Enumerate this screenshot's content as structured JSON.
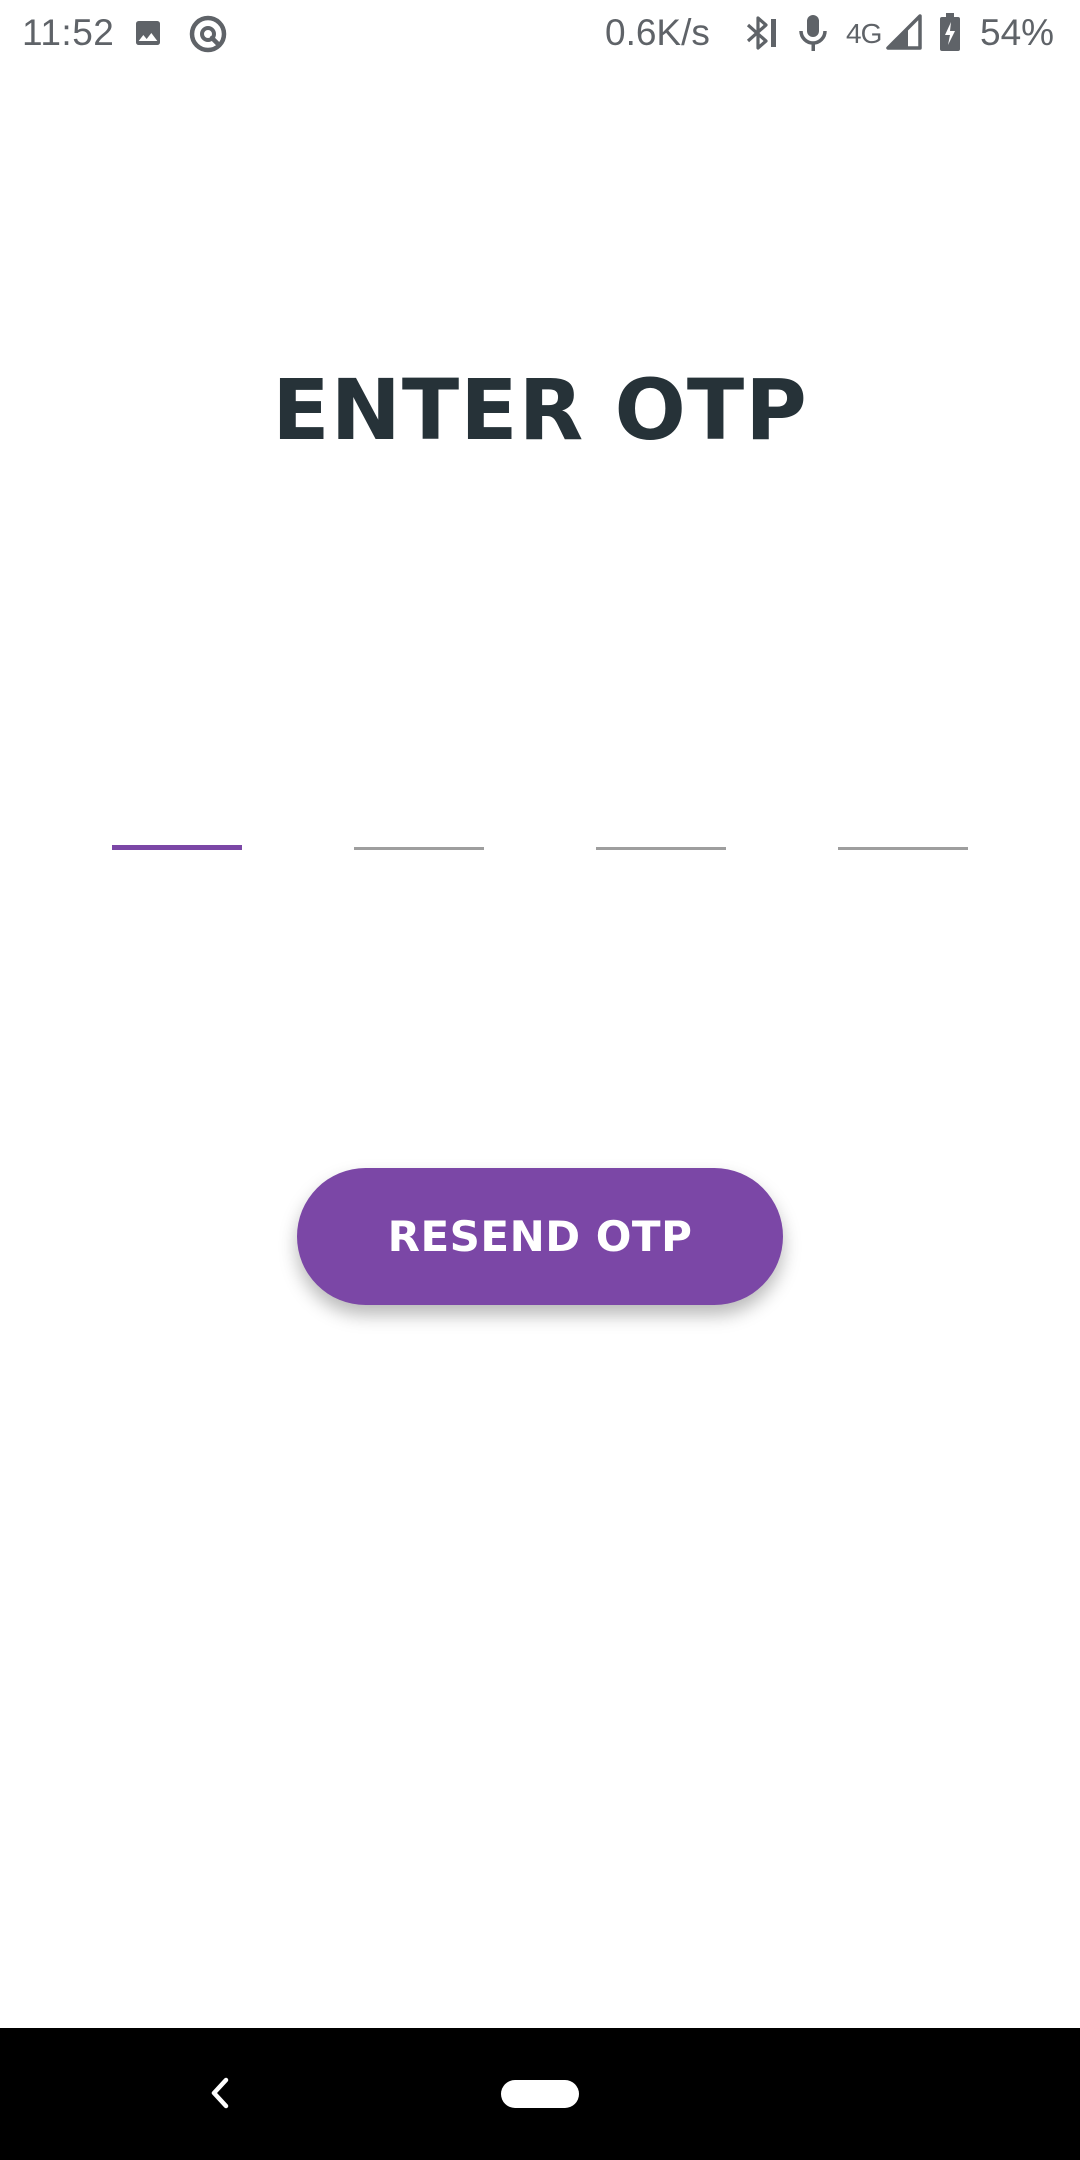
{
  "status_bar": {
    "time": "11:52",
    "network_speed": "0.6K/s",
    "network_type": "4G",
    "battery_percent": "54%",
    "icons": [
      "image-icon",
      "sync-at-icon",
      "bluetooth-icon",
      "microphone-icon",
      "signal-icon",
      "battery-charging-icon"
    ]
  },
  "main": {
    "title": "ENTER OTP",
    "otp_digits": [
      "",
      "",
      "",
      ""
    ],
    "resend_label": "RESEND OTP"
  },
  "colors": {
    "accent": "#7b47a6",
    "title_text": "#263238",
    "inactive_line": "#9e9e9e",
    "nav_background": "#000000"
  },
  "nav_bar": {
    "icons": [
      "back-icon",
      "home-pill-icon"
    ]
  }
}
